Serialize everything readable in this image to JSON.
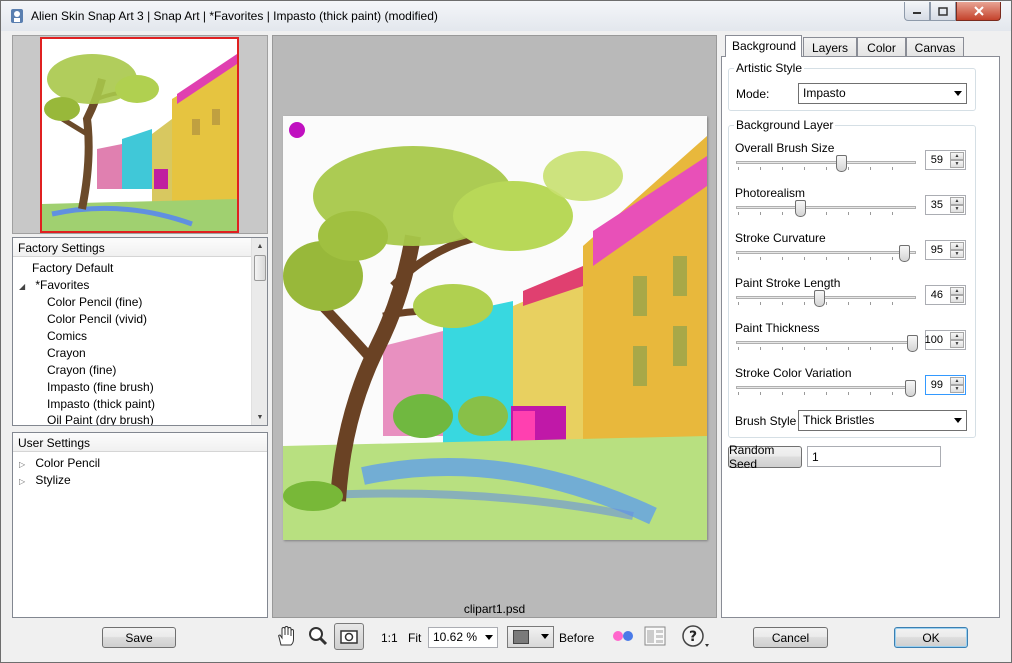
{
  "window": {
    "title": "Alien Skin Snap Art 3 | Snap Art | *Favorites | Impasto (thick paint) (modified)"
  },
  "factory_settings": {
    "header": "Factory Settings",
    "items": [
      {
        "label": "Factory Default"
      },
      {
        "label": "*Favorites"
      },
      {
        "label": "Color Pencil (fine)"
      },
      {
        "label": "Color Pencil (vivid)"
      },
      {
        "label": "Comics"
      },
      {
        "label": "Crayon"
      },
      {
        "label": "Crayon (fine)"
      },
      {
        "label": "Impasto (fine brush)"
      },
      {
        "label": "Impasto (thick paint)"
      },
      {
        "label": "Oil Paint (dry brush)"
      }
    ]
  },
  "user_settings": {
    "header": "User Settings",
    "items": [
      {
        "label": "Color Pencil"
      },
      {
        "label": "Stylize"
      }
    ]
  },
  "preview": {
    "filename": "clipart1.psd"
  },
  "tabs": [
    {
      "label": "Background"
    },
    {
      "label": "Layers"
    },
    {
      "label": "Color"
    },
    {
      "label": "Canvas"
    }
  ],
  "artistic_style": {
    "legend": "Artistic Style",
    "mode_label": "Mode:",
    "mode_value": "Impasto"
  },
  "background_layer": {
    "legend": "Background Layer",
    "sliders": [
      {
        "label": "Overall Brush Size",
        "value": "59"
      },
      {
        "label": "Photorealism",
        "value": "35"
      },
      {
        "label": "Stroke Curvature",
        "value": "95"
      },
      {
        "label": "Paint Stroke Length",
        "value": "46"
      },
      {
        "label": "Paint Thickness",
        "value": "100"
      },
      {
        "label": "Stroke Color Variation",
        "value": "99"
      }
    ],
    "brush_style_label": "Brush Style",
    "brush_style_value": "Thick Bristles"
  },
  "random_seed": {
    "button_label": "Random Seed",
    "value": "1"
  },
  "toolbar": {
    "save_label": "Save",
    "zoom_1to1": "1:1",
    "fit_label": "Fit",
    "zoom_value": "10.62 %",
    "before_label": "Before",
    "cancel_label": "Cancel",
    "ok_label": "OK"
  }
}
